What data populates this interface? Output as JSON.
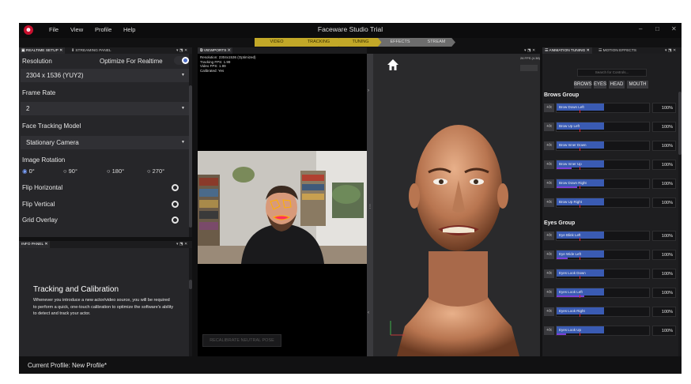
{
  "window": {
    "title": "Faceware Studio Trial",
    "menu": [
      "File",
      "View",
      "Profile",
      "Help"
    ],
    "controls": [
      "–",
      "□",
      "✕"
    ]
  },
  "pipeline": [
    "VIDEO",
    "TRACKING",
    "TUNING",
    "EFFECTS",
    "STREAM"
  ],
  "left_tabs": [
    "REALTIME SETUP",
    "STREAMING PANEL"
  ],
  "settings": {
    "resolution_label": "Resolution",
    "optimize_label": "Optimize For Realtime",
    "optimize_on": true,
    "resolution_value": "2304 x 1536 (YUY2)",
    "frame_rate_label": "Frame Rate",
    "frame_rate_value": "2",
    "tracking_model_label": "Face Tracking Model",
    "tracking_model_value": "Stationary Camera",
    "rotation_label": "Image Rotation",
    "rotations": [
      "0°",
      "90°",
      "180°",
      "270°"
    ],
    "rotation_selected": "0°",
    "flip_h_label": "Flip Horizontal",
    "flip_v_label": "Flip Vertical",
    "grid_label": "Grid Overlay"
  },
  "info_panel": {
    "tab": "INFO PANEL",
    "title": "Tracking and Calibration",
    "body": "Whenever you introduce a new actor/video source, you will be required to perform a quick, one-touch calibration to optimize the software's ability to detect and track your actor."
  },
  "viewport": {
    "tab": "VIEWPORTS",
    "stats": [
      "Resolution: 2304x1536 (Optimized)",
      "Tracking FPS: 1.99",
      "Video FPS: 1.99",
      "Calibrated: Yes"
    ],
    "recalibrate_label": "RECALIBRATE NEUTRAL POSE"
  },
  "view3d": {
    "fps": "26 FPS (4.38)"
  },
  "tuning": {
    "tabs": [
      "ANIMATION TUNING",
      "MOTION EFFECTS"
    ],
    "search_placeholder": "Search for Controls...",
    "filters": [
      "BROWS",
      "EYES",
      "HEAD",
      "MOUTH"
    ],
    "fx_label": "+/x",
    "groups": [
      {
        "name": "Brows Group",
        "controls": [
          {
            "name": "Brow Down Left",
            "value": "100%",
            "level": 0.0,
            "mark": 0.25
          },
          {
            "name": "Brow Up Left",
            "value": "100%",
            "level": 0.0,
            "mark": 0.25
          },
          {
            "name": "Brow Inner Down",
            "value": "100%",
            "level": 0.0,
            "mark": 0.25
          },
          {
            "name": "Brow Inner Up",
            "value": "100%",
            "level": 0.16,
            "mark": 0.25
          },
          {
            "name": "Brow Down Right",
            "value": "100%",
            "level": 0.22,
            "mark": 0.25
          },
          {
            "name": "Brow Up Right",
            "value": "100%",
            "level": 0.0,
            "mark": 0.25
          }
        ]
      },
      {
        "name": "Eyes Group",
        "controls": [
          {
            "name": "Eye Blink Left",
            "value": "100%",
            "level": 0.0,
            "mark": 0.25
          },
          {
            "name": "Eye Wide Left",
            "value": "100%",
            "level": 0.12,
            "mark": 0.25
          },
          {
            "name": "Eyes Look Down",
            "value": "100%",
            "level": 0.0,
            "mark": 0.25
          },
          {
            "name": "Eyes Look Left",
            "value": "100%",
            "level": 0.3,
            "mark": 0.25
          },
          {
            "name": "Eyes Look Right",
            "value": "100%",
            "level": 0.0,
            "mark": 0.25
          },
          {
            "name": "Eyes Look Up",
            "value": "100%",
            "level": 0.1,
            "mark": 0.25
          }
        ]
      }
    ]
  },
  "status": {
    "profile": "Current Profile: New Profile*"
  }
}
